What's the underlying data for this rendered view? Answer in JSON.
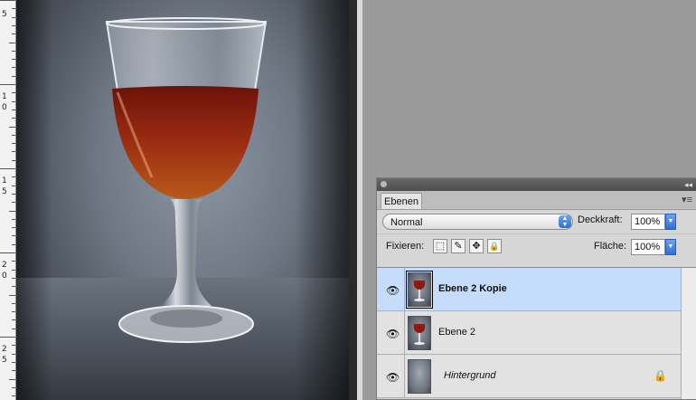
{
  "ruler": {
    "labels": [
      {
        "text": "5",
        "pos": 12
      },
      {
        "text": "1",
        "pos": 103
      },
      {
        "text": "0",
        "pos": 115
      },
      {
        "text": "1",
        "pos": 196
      },
      {
        "text": "5",
        "pos": 208
      },
      {
        "text": "2",
        "pos": 289
      },
      {
        "text": "0",
        "pos": 301
      },
      {
        "text": "2",
        "pos": 382
      },
      {
        "text": "5",
        "pos": 394
      }
    ]
  },
  "layers_panel": {
    "collapse_glyph": "◂◂",
    "tab_label": "Ebenen",
    "menu_glyph": "▾≡",
    "blend_mode": "Normal",
    "opacity_label": "Deckkraft:",
    "opacity_value": "100%",
    "lock_label": "Fixieren:",
    "fill_label": "Fläche:",
    "fill_value": "100%",
    "lock_buttons": [
      "⬚",
      "✎",
      "✥",
      "🔒"
    ],
    "layers": [
      {
        "name": "Ebene 2 Kopie",
        "selected": true
      },
      {
        "name": "Ebene 2",
        "selected": false
      },
      {
        "name": "Hintergrund",
        "selected": false,
        "locked": true
      }
    ]
  },
  "icons": {
    "eye": "eye-icon",
    "lock": "lock-icon",
    "lock_glyph": "🔒"
  },
  "colors": {
    "accent": "#2e6fd6",
    "selection": "#c6dcfb",
    "wine": "#8e1b10"
  }
}
